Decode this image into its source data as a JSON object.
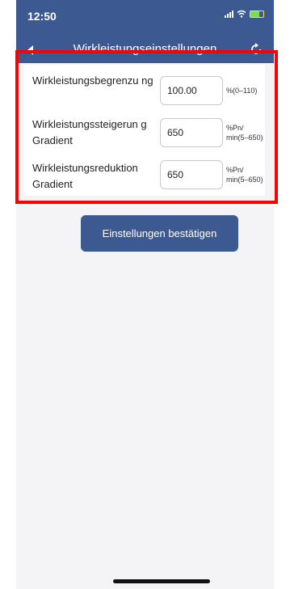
{
  "status_bar": {
    "time": "12:50"
  },
  "header": {
    "title": "Wirkleistungseinstellungen"
  },
  "form": {
    "rows": [
      {
        "label": "Wirkleistungsbegrenzu ng",
        "value": "100.00",
        "unit": "%(0–110)"
      },
      {
        "label": "Wirkleistungssteigerun g Gradient",
        "value": "650",
        "unit": "%Pn/ min(5–650)"
      },
      {
        "label": "Wirkleistungsreduktion Gradient",
        "value": "650",
        "unit": "%Pn/ min(5–650)"
      }
    ]
  },
  "confirm_button": {
    "label": "Einstellungen bestätigen"
  },
  "colors": {
    "accent": "#3c5a91",
    "highlight": "#ff0000"
  },
  "icons": [
    "back-icon",
    "refresh-icon",
    "signal-icon",
    "wifi-icon",
    "battery-icon"
  ]
}
